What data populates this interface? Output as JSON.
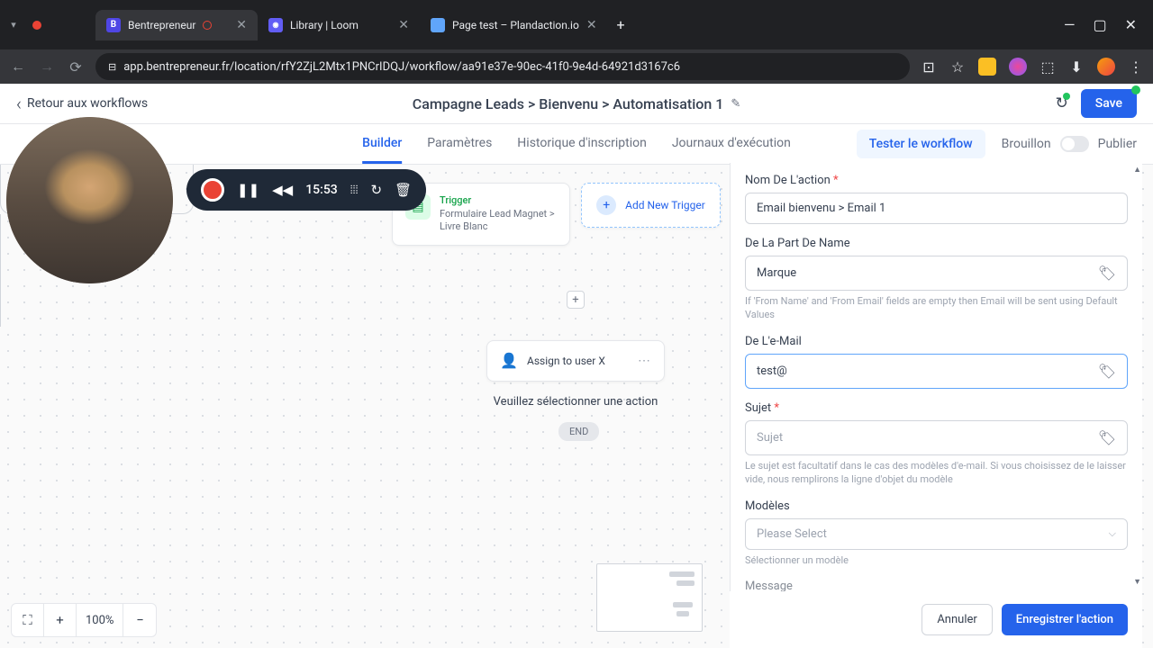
{
  "browser": {
    "tabs": [
      {
        "title": "Bentrepreneur",
        "favicon_bg": "#4f46e5",
        "favicon_text": "B",
        "active": true,
        "recording": true
      },
      {
        "title": "Library | Loom",
        "favicon_bg": "#625df5",
        "favicon_text": "●"
      },
      {
        "title": "Page test – Plandaction.io",
        "favicon_bg": "#60a5fa",
        "favicon_text": ""
      }
    ],
    "url": "app.bentrepreneur.fr/location/rfY2ZjL2Mtx1PNCrIDQJ/workflow/aa91e37e-90ec-41f0-9e4d-64921d3167c6"
  },
  "header": {
    "back": "Retour aux workflows",
    "breadcrumb": "Campagne Leads > Bienvenu > Automatisation 1",
    "save": "Save"
  },
  "tabs": {
    "items": [
      "Builder",
      "Paramètres",
      "Historique d'inscription",
      "Journaux d'exécution"
    ],
    "test": "Tester le workflow",
    "draft": "Brouillon",
    "publish": "Publier"
  },
  "canvas": {
    "trigger": {
      "title": "Trigger",
      "subtitle": "Formulaire Lead Magnet > Livre Blanc"
    },
    "add_trigger": "Add New Trigger",
    "assign": "Assign to user X",
    "select_action": "Veuillez sélectionner une action",
    "end": "END",
    "zoom": "100%"
  },
  "panel": {
    "name_label": "Nom De L'action",
    "name_value": "Email bienvenu > Email 1",
    "from_name_label": "De La Part De Name",
    "from_name_value": "Marque",
    "from_name_help": "If 'From Name' and 'From Email' fields are empty then Email will be sent using Default Values",
    "from_email_label": "De L'e-Mail",
    "from_email_value": "test@",
    "subject_label": "Sujet",
    "subject_placeholder": "Sujet",
    "subject_help": "Le sujet est facultatif dans le cas des modèles d'e-mail. Si vous choisissez de le laisser vide, nous remplirons la ligne d'objet du modèle",
    "templates_label": "Modèles",
    "templates_placeholder": "Please Select",
    "templates_help": "Sélectionner un modèle",
    "message_label": "Message",
    "cancel": "Annuler",
    "save": "Enregistrer l'action"
  },
  "loom": {
    "time": "15:53"
  }
}
